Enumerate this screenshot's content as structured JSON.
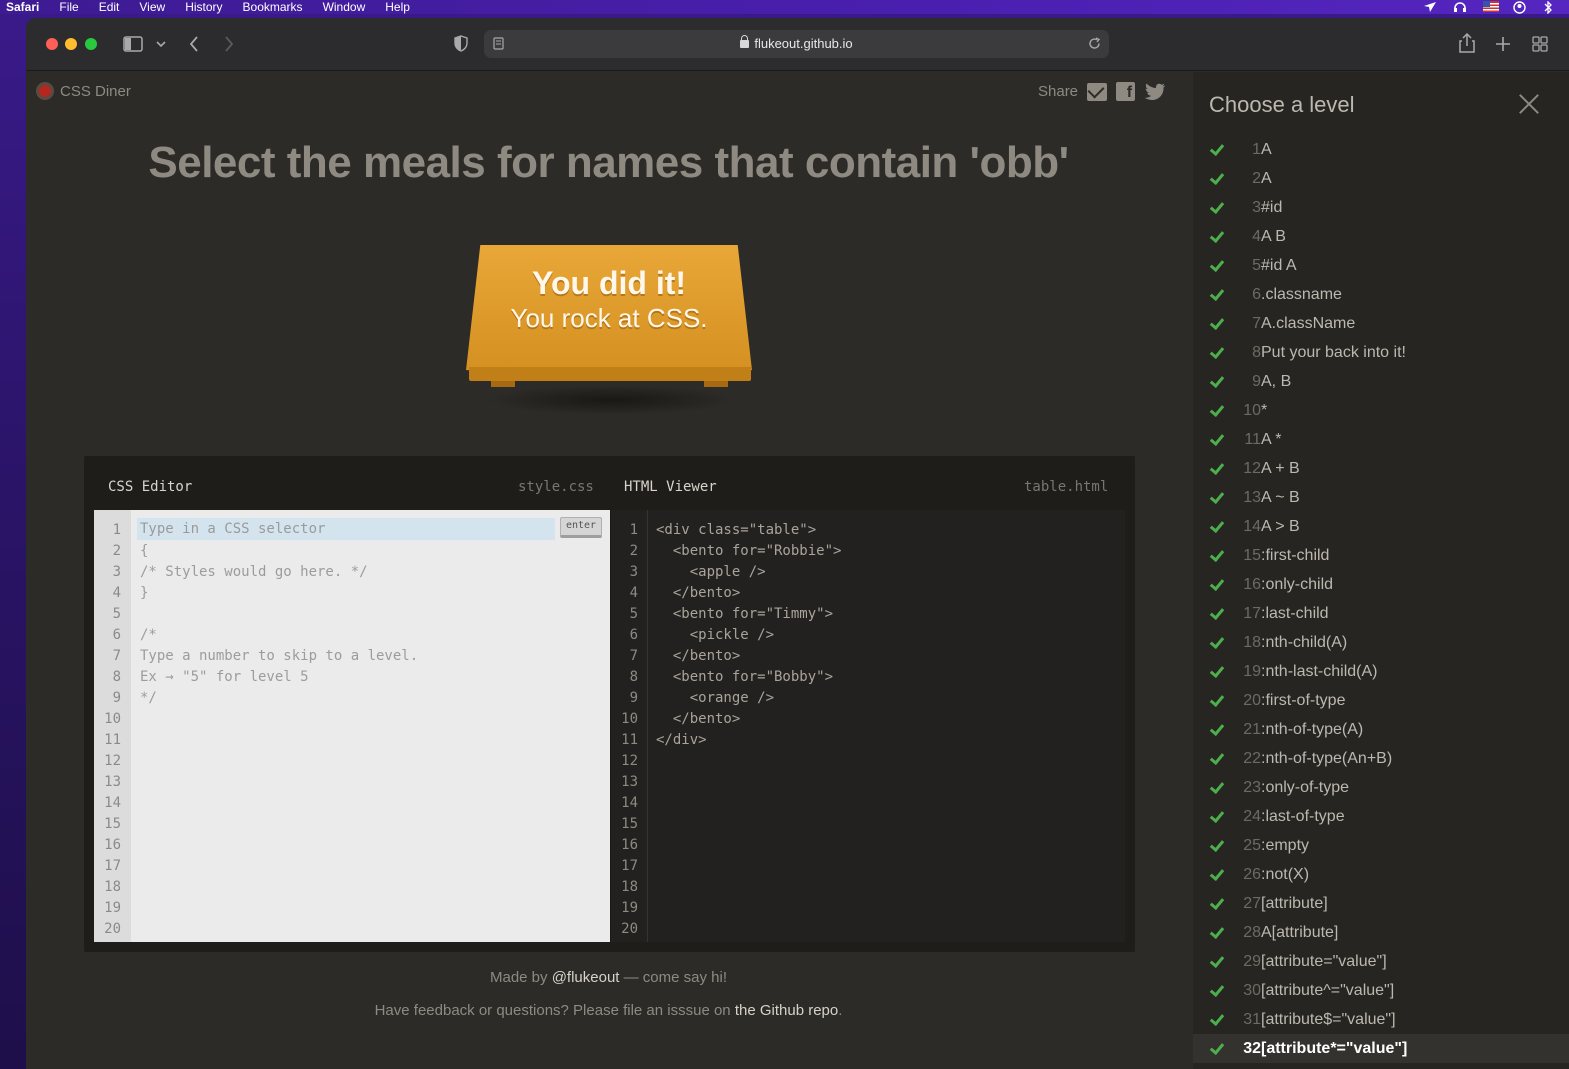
{
  "menubar": {
    "items": [
      "Safari",
      "File",
      "Edit",
      "View",
      "History",
      "Bookmarks",
      "Window",
      "Help"
    ]
  },
  "browser": {
    "url": "flukeout.github.io",
    "icons": [
      "sidebar-icon",
      "chevron-down-icon",
      "back-icon",
      "forward-icon",
      "shield-icon",
      "page-icon",
      "lock-icon",
      "reload-icon",
      "share-icon",
      "new-tab-icon",
      "tab-overview-icon"
    ]
  },
  "app": {
    "logo": "CSS Diner",
    "share_label": "Share",
    "instruction": "Select the meals for names that contain 'obb'",
    "win_line1": "You did it!",
    "win_line2": "You rock at CSS."
  },
  "css_editor": {
    "title": "CSS Editor",
    "file": "style.css",
    "placeholder": "Type in a CSS selector",
    "enter_label": "enter",
    "lines": [
      "{",
      "/* Styles would go here. */",
      "}",
      "",
      "/*",
      "Type a number to skip to a level.",
      "Ex → \"5\" for level 5",
      "*/"
    ],
    "line_numbers": [
      "1",
      "2",
      "3",
      "4",
      "5",
      "6",
      "7",
      "8",
      "9",
      "10",
      "11",
      "12",
      "13",
      "14",
      "15",
      "16",
      "17",
      "18",
      "19",
      "20"
    ]
  },
  "html_viewer": {
    "title": "HTML Viewer",
    "file": "table.html",
    "lines": [
      "<div class=\"table\">",
      "  <bento for=\"Robbie\">",
      "    <apple />",
      "  </bento>",
      "  <bento for=\"Timmy\">",
      "    <pickle />",
      "  </bento>",
      "  <bento for=\"Bobby\">",
      "    <orange />",
      "  </bento>",
      "</div>"
    ],
    "line_numbers": [
      "1",
      "2",
      "3",
      "4",
      "5",
      "6",
      "7",
      "8",
      "9",
      "10",
      "11",
      "12",
      "13",
      "14",
      "15",
      "16",
      "17",
      "18",
      "19",
      "20"
    ]
  },
  "footer": {
    "line1_pre": "Made by ",
    "line1_link": "@flukeout",
    "line1_post": " — come say hi!",
    "line2_pre": "Have feedback or questions? Please file an isssue on ",
    "line2_link": "the Github repo",
    "line2_post": "."
  },
  "sidebar": {
    "title": "Choose a level",
    "current_level": "32",
    "levels": [
      {
        "num": "1",
        "name": "A"
      },
      {
        "num": "2",
        "name": "A"
      },
      {
        "num": "3",
        "name": "#id"
      },
      {
        "num": "4",
        "name": "A  B"
      },
      {
        "num": "5",
        "name": "#id  A"
      },
      {
        "num": "6",
        "name": ".classname"
      },
      {
        "num": "7",
        "name": "A.className"
      },
      {
        "num": "8",
        "name": "Put your back into it!"
      },
      {
        "num": "9",
        "name": "A, B"
      },
      {
        "num": "10",
        "name": "*"
      },
      {
        "num": "11",
        "name": "A  *"
      },
      {
        "num": "12",
        "name": "A + B"
      },
      {
        "num": "13",
        "name": "A ~ B"
      },
      {
        "num": "14",
        "name": "A > B"
      },
      {
        "num": "15",
        "name": ":first-child"
      },
      {
        "num": "16",
        "name": ":only-child"
      },
      {
        "num": "17",
        "name": ":last-child"
      },
      {
        "num": "18",
        "name": ":nth-child(A)"
      },
      {
        "num": "19",
        "name": ":nth-last-child(A)"
      },
      {
        "num": "20",
        "name": ":first-of-type"
      },
      {
        "num": "21",
        "name": ":nth-of-type(A)"
      },
      {
        "num": "22",
        "name": ":nth-of-type(An+B)"
      },
      {
        "num": "23",
        "name": ":only-of-type"
      },
      {
        "num": "24",
        "name": ":last-of-type"
      },
      {
        "num": "25",
        "name": ":empty"
      },
      {
        "num": "26",
        "name": ":not(X)"
      },
      {
        "num": "27",
        "name": "[attribute]"
      },
      {
        "num": "28",
        "name": "A[attribute]"
      },
      {
        "num": "29",
        "name": "[attribute=\"value\"]"
      },
      {
        "num": "30",
        "name": "[attribute^=\"value\"]"
      },
      {
        "num": "31",
        "name": "[attribute$=\"value\"]"
      },
      {
        "num": "32",
        "name": "[attribute*=\"value\"]"
      }
    ]
  },
  "colors": {
    "accent_table": "#e0a030",
    "check_green": "#4cae4c",
    "page_bg": "#2d2b27"
  }
}
